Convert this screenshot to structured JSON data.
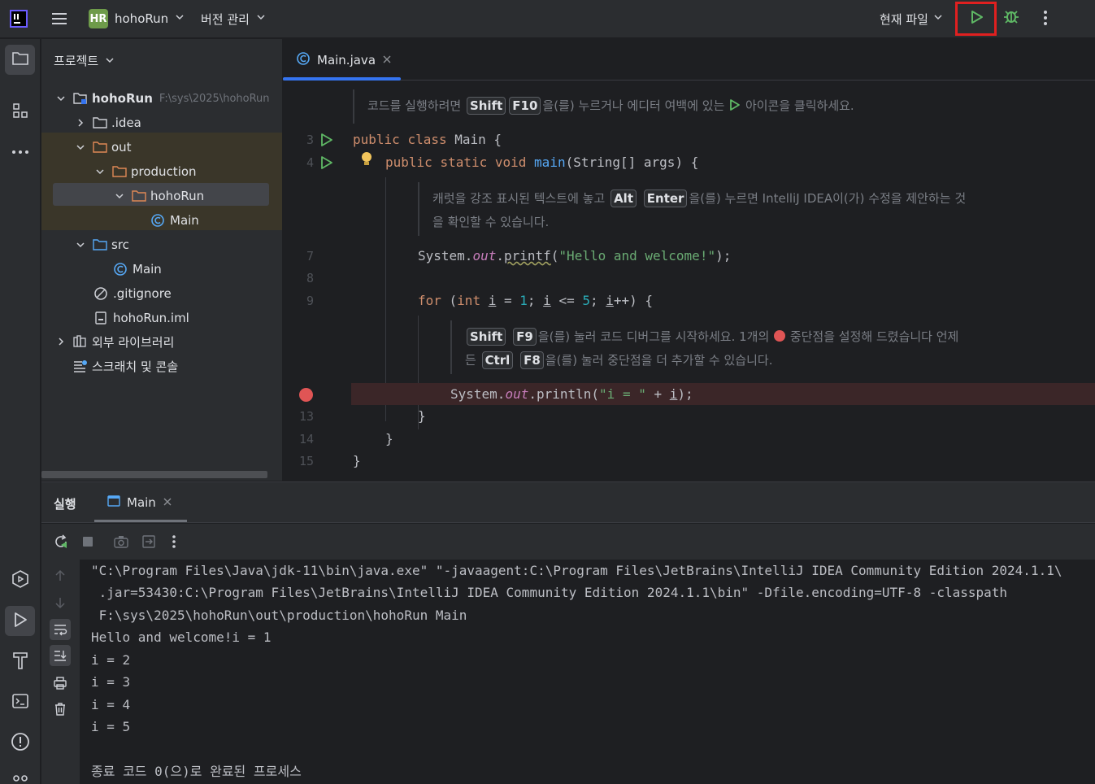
{
  "header": {
    "project_badge": "HR",
    "project_name": "hohoRun",
    "vcs_label": "버전 관리",
    "run_config": "현재 파일"
  },
  "project_panel": {
    "title": "프로젝트",
    "tree": [
      {
        "label": "hohoRun",
        "path": "F:\\sys\\2025\\hohoRun"
      },
      {
        "label": ".idea"
      },
      {
        "label": "out"
      },
      {
        "label": "production"
      },
      {
        "label": "hohoRun"
      },
      {
        "label": "Main"
      },
      {
        "label": "src"
      },
      {
        "label": "Main"
      },
      {
        "label": ".gitignore"
      },
      {
        "label": "hohoRun.iml"
      },
      {
        "label": "외부 라이브러리"
      },
      {
        "label": "스크래치 및 콘솔"
      }
    ]
  },
  "editor": {
    "tab_label": "Main.java",
    "hint1": {
      "pre": "코드를 실행하려면",
      "key1": "Shift",
      "key2": "F10",
      "post": "을(를) 누르거나 에디터 여백에 있는",
      "post2": "아이콘을 클릭하세요."
    },
    "hint2": {
      "pre": "캐럿을 강조 표시된 텍스트에 놓고",
      "key1": "Alt",
      "key2": "Enter",
      "post": "을(를) 누르면 IntelliJ IDEA이(가) 수정을 제안하는 것",
      "line2": "을 확인할 수 있습니다."
    },
    "hint3": {
      "key1": "Shift",
      "key2": "F9",
      "post": "을(를) 눌러 코드 디버그를 시작하세요. 1개의",
      "post2": "중단점을 설정해 드렸습니다 언제",
      "line2_pre": "든",
      "key3": "Ctrl",
      "key4": "F8",
      "line2_post": "을(를) 눌러 중단점을 더 추가할 수 있습니다."
    },
    "line_numbers": [
      "3",
      "4",
      "7",
      "8",
      "9",
      "13",
      "14",
      "15"
    ],
    "code": {
      "l3_kw1": "public",
      "l3_kw2": "class",
      "l3_rest": " Main {",
      "l4_kw1": "public",
      "l4_kw2": "static",
      "l4_kw3": "void",
      "l4_fn": "main",
      "l4_rest": "(String[] args) {",
      "l7_a": "System.",
      "l7_out": "out",
      "l7_b": ".",
      "l7_fn": "printf",
      "l7_c": "(",
      "l7_str": "\"Hello and welcome!\"",
      "l7_d": ");",
      "l9_kw": "for",
      "l9_a": " (",
      "l9_kw2": "int",
      "l9_i1": "i",
      "l9_b": " = ",
      "l9_n1": "1",
      "l9_c": "; ",
      "l9_i2": "i",
      "l9_d": " <= ",
      "l9_n2": "5",
      "l9_e": "; ",
      "l9_i3": "i",
      "l9_f": "++) {",
      "l12_a": "System.",
      "l12_out": "out",
      "l12_b": ".println(",
      "l12_str": "\"i = \"",
      "l12_c": " + ",
      "l12_i": "i",
      "l12_d": ");",
      "l13": "}",
      "l14": "}",
      "l15": "}"
    }
  },
  "run_panel": {
    "title": "실행",
    "tab_label": "Main",
    "console": [
      "\"C:\\Program Files\\Java\\jdk-11\\bin\\java.exe\" \"-javaagent:C:\\Program Files\\JetBrains\\IntelliJ IDEA Community Edition 2024.1.1\\",
      " .jar=53430:C:\\Program Files\\JetBrains\\IntelliJ IDEA Community Edition 2024.1.1\\bin\" -Dfile.encoding=UTF-8 -classpath",
      " F:\\sys\\2025\\hohoRun\\out\\production\\hohoRun Main",
      "Hello and welcome!i = 1",
      "i = 2",
      "i = 3",
      "i = 4",
      "i = 5",
      "",
      "종료 코드 0(으)로 완료된 프로세스"
    ]
  },
  "colors": {
    "accent": "#3574f0",
    "run_green": "#5fb865",
    "breakpoint": "#e05555",
    "highlight_box": "#e02020"
  }
}
